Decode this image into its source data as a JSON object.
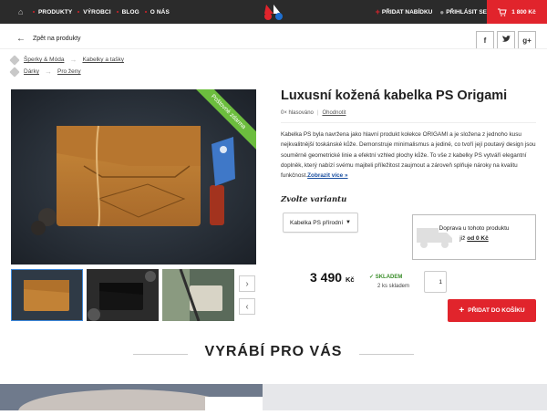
{
  "nav": {
    "items": [
      "PRODUKTY",
      "VÝROBCI",
      "BLOG",
      "O NÁS"
    ],
    "add_offer": "PŘIDAT NABÍDKU",
    "login": "PŘIHLÁSIT SE",
    "cart_total": "1 800 Kč"
  },
  "back_label": "Zpět na produkty",
  "share": [
    "f",
    "t",
    "g+"
  ],
  "breadcrumbs": [
    {
      "root": "Šperky & Móda",
      "child": "Kabelky a tašky"
    },
    {
      "root": "Dárky",
      "child": "Pro ženy"
    }
  ],
  "ribbon": "Poštovné zdarma",
  "product": {
    "title": "Luxusní kožená kabelka PS Origami",
    "votes": "0× hlasováno",
    "rate_link": "Ohodnotit",
    "description": "Kabelka PS byla navržena jako hlavní produkt kolekce ORIGAMI a je složena z jednoho kusu nejkvalitnější toskánské kůže. Demonstruje minimalismus a jediné, co tvoří její poutavý design jsou souměrně geometrické linie a efektní vzhled plochy kůže. To vše z kabelky PS vytváří elegantní doplněk, který nabízí svému majiteli příležitost zaujmout a zároveň splňuje nároky na kvalitu funkčnost.",
    "more": "Zobrazit více »",
    "variant_label": "Zvolte variantu",
    "variant_selected": "Kabelka PS přírodní",
    "delivery_line1": "Doprava u tohoto produktu",
    "delivery_prefix": "již",
    "delivery_amount": "od 0 Kč",
    "price": "3 490",
    "currency": "Kč",
    "stock_status": "SKLADEM",
    "stock_count": "2 ks skladem",
    "quantity": "1",
    "add_to_cart": "PŘIDAT DO KOŠÍKU"
  },
  "section_title": "VYRÁBÍ PRO VÁS",
  "colors": {
    "accent": "#e1242c",
    "dark": "#2b2b2b",
    "ribbon": "#6cbd3e",
    "stock": "#3b8e2b"
  }
}
